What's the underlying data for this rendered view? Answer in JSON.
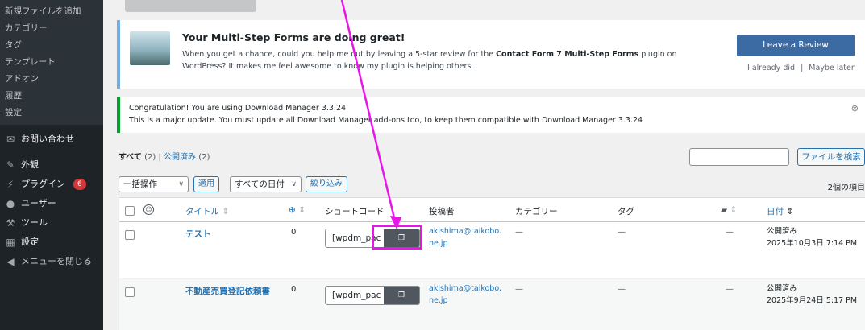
{
  "sidebar": {
    "sub_items": [
      {
        "label": "新規ファイルを追加"
      },
      {
        "label": "カテゴリー"
      },
      {
        "label": "タグ"
      },
      {
        "label": "テンプレート"
      },
      {
        "label": "アドオン"
      },
      {
        "label": "履歴"
      },
      {
        "label": "設定"
      }
    ],
    "menu": [
      {
        "label": "お問い合わせ",
        "icon": "mail-icon"
      },
      {
        "label": "外観",
        "icon": "brush-icon"
      },
      {
        "label": "プラグイン",
        "icon": "plugin-icon",
        "badge": "6"
      },
      {
        "label": "ユーザー",
        "icon": "user-icon"
      },
      {
        "label": "ツール",
        "icon": "wrench-icon"
      },
      {
        "label": "設定",
        "icon": "settings-icon"
      },
      {
        "label": "メニューを閉じる",
        "icon": "collapse-icon"
      }
    ]
  },
  "notice_review": {
    "title": "Your Multi-Step Forms are doing great!",
    "body_pre": "When you get a chance, could you help me out by leaving a 5-star review for the ",
    "body_bold": "Contact Form 7 Multi-Step Forms",
    "body_post": " plugin on WordPress? It makes me feel awesome to know my plugin is helping others.",
    "button": "Leave a Review",
    "link_done": "I already did",
    "separator": "|",
    "link_later": "Maybe later"
  },
  "notice_update": {
    "line1": "Congratulation! You are using Download Manager 3.3.24",
    "line2": "This is a major update. You must update all Download Manager add-ons too, to keep them compatible with Download Manager 3.3.24"
  },
  "filters": {
    "all_label": "すべて",
    "all_count": "(2)",
    "sep": "|",
    "published_label": "公開済み",
    "published_count": "(2)",
    "search_button": "ファイルを検索",
    "bulk_action": "一括操作",
    "apply": "適用",
    "all_dates": "すべての日付",
    "filter": "絞り込み",
    "items_count": "2個の項目"
  },
  "table": {
    "headers": {
      "title": "タイトル",
      "shortcode": "ショートコード",
      "author": "投稿者",
      "category": "カテゴリー",
      "tags": "タグ",
      "date": "日付"
    },
    "rows": [
      {
        "title": "テスト",
        "downloads": "0",
        "shortcode": "[wpdm_pac",
        "author": "akishima@taikobo.ne.jp",
        "category": "—",
        "tags": "—",
        "comments": "—",
        "status": "公開済み",
        "date": "2025年10月3日 7:14 PM"
      },
      {
        "title": "不動産売買登記依頼書",
        "downloads": "0",
        "shortcode": "[wpdm_pac",
        "author": "akishima@taikobo.ne.jp",
        "category": "—",
        "tags": "—",
        "comments": "—",
        "status": "公開済み",
        "date": "2025年9月24日 5:17 PM"
      }
    ]
  },
  "colors": {
    "highlight": "#e815e8",
    "link": "#2271b1",
    "sidebar": "#1d2327"
  }
}
